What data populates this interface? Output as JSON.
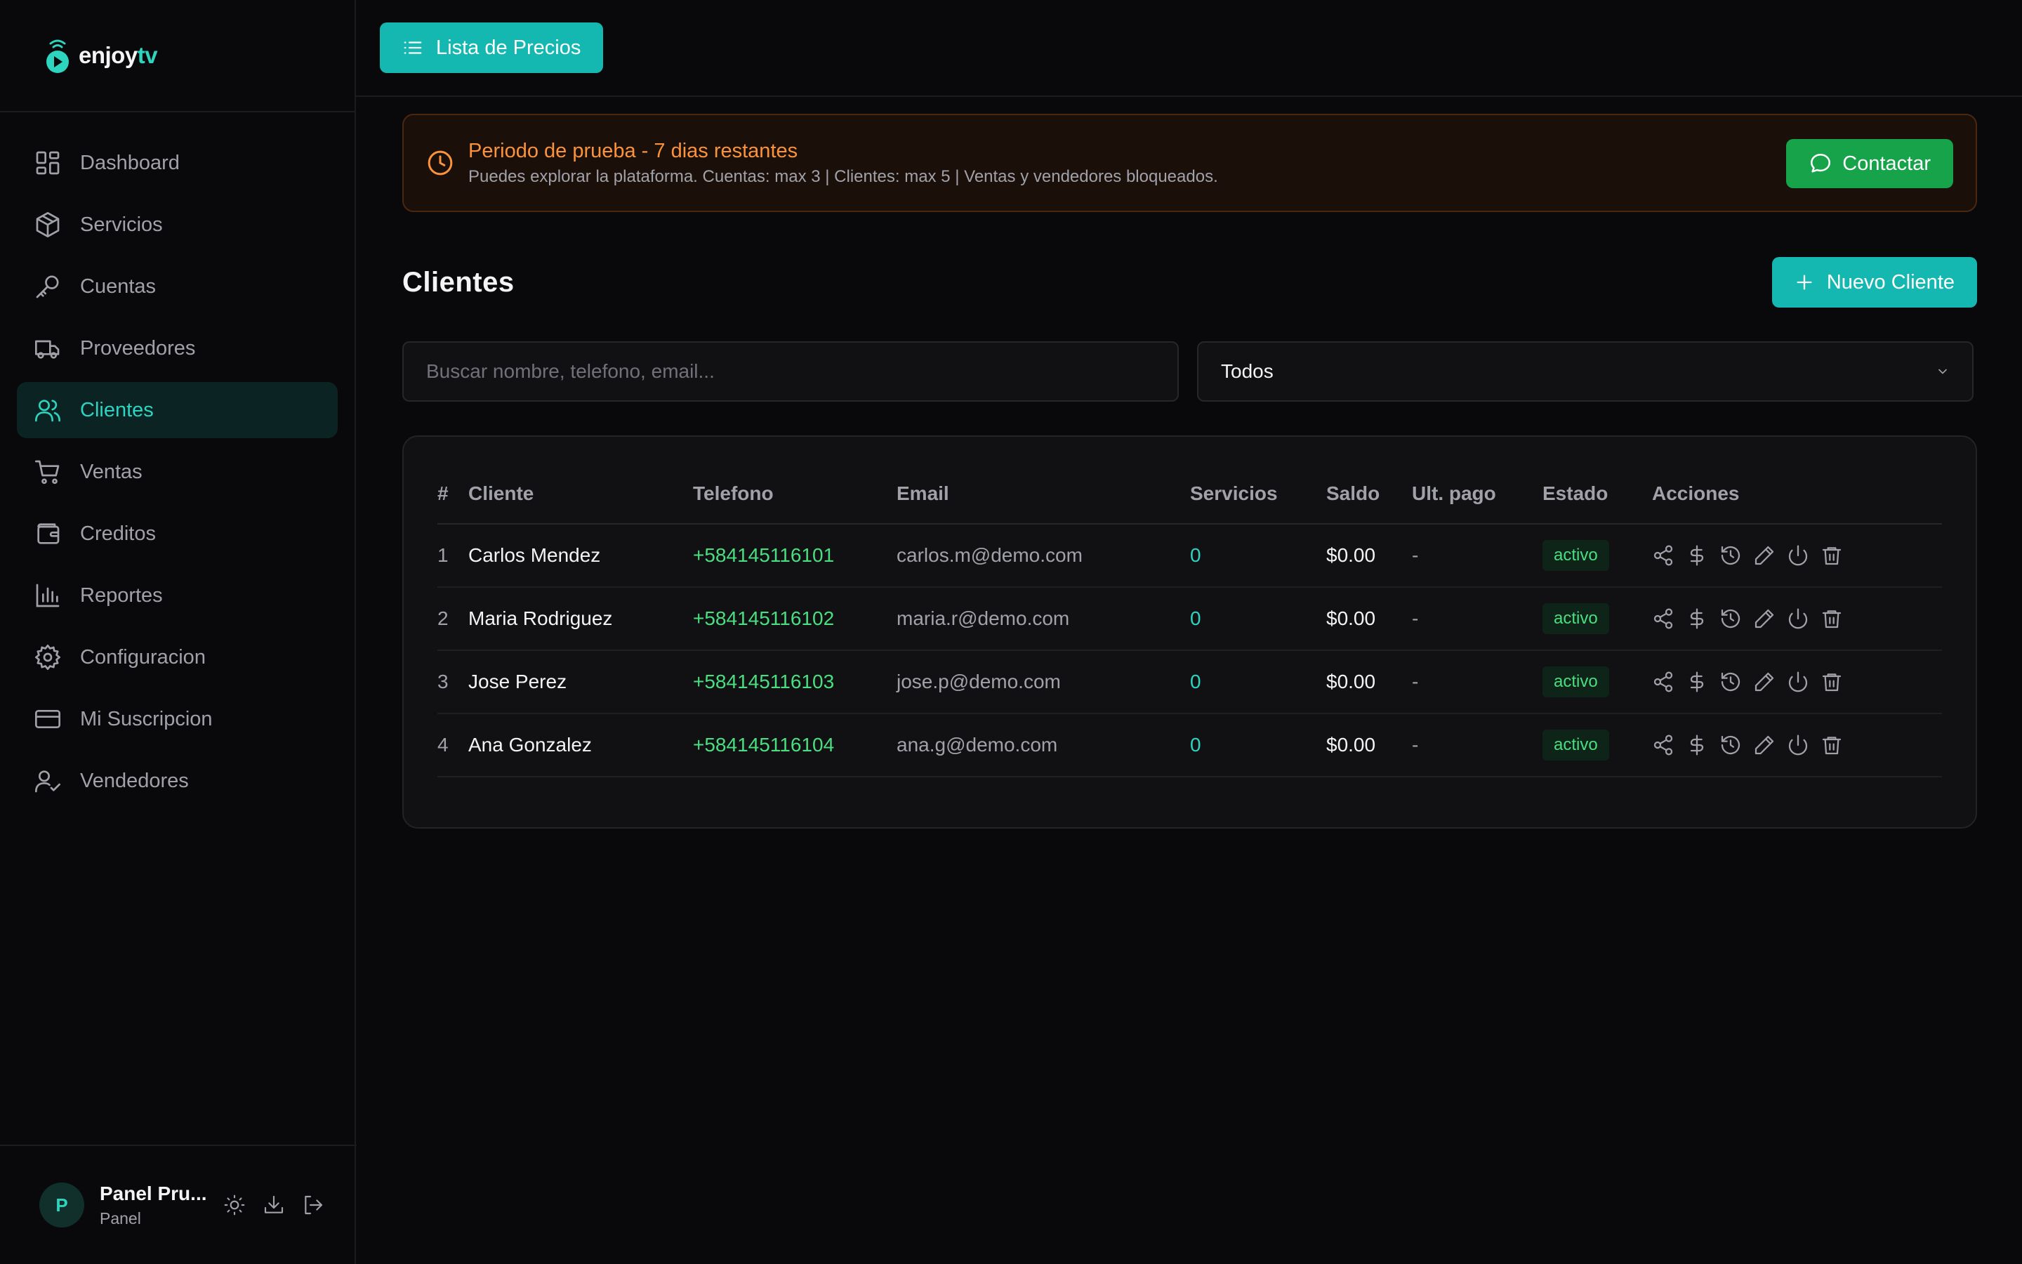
{
  "brand": {
    "name_part1": "enjoy",
    "name_part2": "tv",
    "accent": "#2dd4bf"
  },
  "sidebar": {
    "items": [
      {
        "label": "Dashboard",
        "icon": "dashboard-icon"
      },
      {
        "label": "Servicios",
        "icon": "box-icon"
      },
      {
        "label": "Cuentas",
        "icon": "key-icon"
      },
      {
        "label": "Proveedores",
        "icon": "truck-icon"
      },
      {
        "label": "Clientes",
        "icon": "users-icon",
        "active": true
      },
      {
        "label": "Ventas",
        "icon": "cart-icon"
      },
      {
        "label": "Creditos",
        "icon": "wallet-icon"
      },
      {
        "label": "Reportes",
        "icon": "bar-chart-icon"
      },
      {
        "label": "Configuracion",
        "icon": "gear-icon"
      },
      {
        "label": "Mi Suscripcion",
        "icon": "credit-card-icon"
      },
      {
        "label": "Vendedores",
        "icon": "user-check-icon"
      }
    ]
  },
  "user": {
    "initial": "P",
    "name": "Panel Pru...",
    "role": "Panel"
  },
  "topbar": {
    "price_list_label": "Lista de Precios"
  },
  "trial": {
    "title": "Periodo de prueba - 7 dias restantes",
    "subtitle": "Puedes explorar la plataforma. Cuentas: max 3 | Clientes: max 5 | Ventas y vendedores bloqueados.",
    "contact_label": "Contactar"
  },
  "page": {
    "title": "Clientes",
    "new_client_label": "Nuevo Cliente",
    "search_placeholder": "Buscar nombre, telefono, email...",
    "filter_value": "Todos"
  },
  "table": {
    "headers": [
      "#",
      "Cliente",
      "Telefono",
      "Email",
      "Servicios",
      "Saldo",
      "Ult. pago",
      "Estado",
      "Acciones"
    ],
    "rows": [
      {
        "num": "1",
        "name": "Carlos Mendez",
        "phone": "+584145116101",
        "email": "carlos.m@demo.com",
        "services": "0",
        "balance": "$0.00",
        "last_payment": "-",
        "status": "activo"
      },
      {
        "num": "2",
        "name": "Maria Rodriguez",
        "phone": "+584145116102",
        "email": "maria.r@demo.com",
        "services": "0",
        "balance": "$0.00",
        "last_payment": "-",
        "status": "activo"
      },
      {
        "num": "3",
        "name": "Jose Perez",
        "phone": "+584145116103",
        "email": "jose.p@demo.com",
        "services": "0",
        "balance": "$0.00",
        "last_payment": "-",
        "status": "activo"
      },
      {
        "num": "4",
        "name": "Ana Gonzalez",
        "phone": "+584145116104",
        "email": "ana.g@demo.com",
        "services": "0",
        "balance": "$0.00",
        "last_payment": "-",
        "status": "activo"
      }
    ]
  }
}
